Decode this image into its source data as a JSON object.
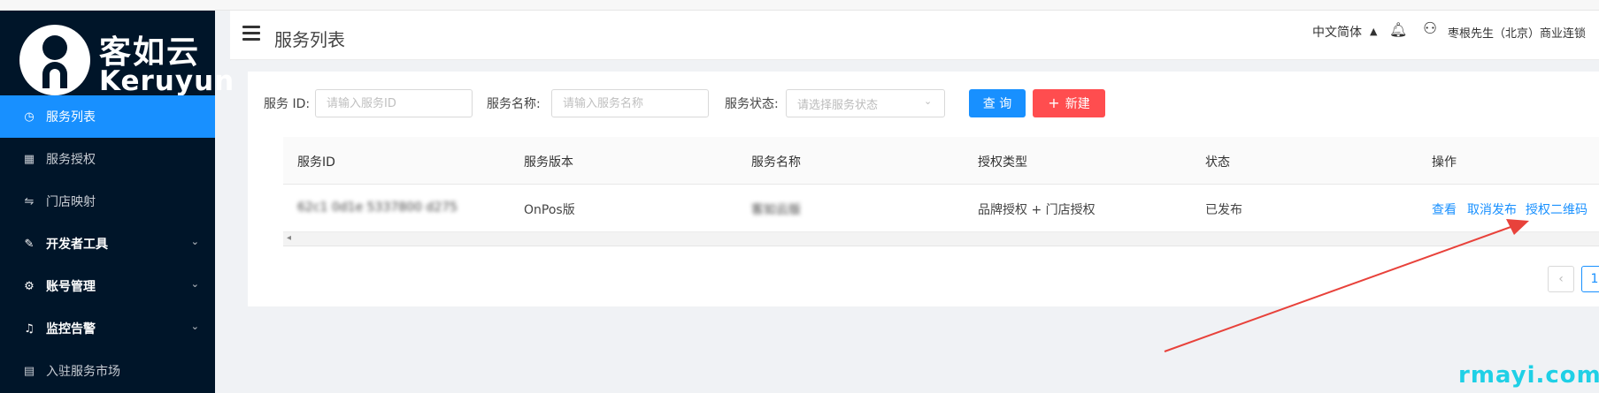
{
  "logo": {
    "cn": "客如云",
    "en": "Keruyun"
  },
  "sidebar": {
    "items": [
      {
        "label": "服务列表",
        "icon": "dashboard-icon"
      },
      {
        "label": "服务授权",
        "icon": "table-icon"
      },
      {
        "label": "门店映射",
        "icon": "swap-icon"
      },
      {
        "label": "开发者工具",
        "icon": "tool-icon"
      },
      {
        "label": "账号管理",
        "icon": "gear-icon"
      },
      {
        "label": "监控告警",
        "icon": "bell-icon"
      },
      {
        "label": "入驻服务市场",
        "icon": "store-icon"
      }
    ]
  },
  "header": {
    "title": "服务列表",
    "language": "中文简体",
    "user_name": "枣根先生（北京）商业连锁"
  },
  "filters": {
    "service_id_label": "服务 ID:",
    "service_id_placeholder": "请输入服务ID",
    "service_name_label": "服务名称:",
    "service_name_placeholder": "请输入服务名称",
    "service_status_label": "服务状态:",
    "service_status_placeholder": "请选择服务状态",
    "query_button": "查 询",
    "new_button": "新建"
  },
  "table": {
    "columns": [
      "服务ID",
      "服务版本",
      "服务名称",
      "授权类型",
      "状态",
      "操作"
    ],
    "rows": [
      {
        "id": "62c1 0d1e 5337800     d275",
        "version": "OnPos版",
        "name": "客如云版",
        "auth_type": "品牌授权 + 门店授权",
        "status": "已发布",
        "actions": [
          "查看",
          "取消发布",
          "授权二维码"
        ]
      }
    ]
  },
  "pagination": {
    "current": "1"
  },
  "watermark": "rmayi.com",
  "colors": {
    "primary": "#1890ff",
    "danger": "#ff4d4f",
    "sidebar": "#001529",
    "arrow": "#e8423b"
  }
}
